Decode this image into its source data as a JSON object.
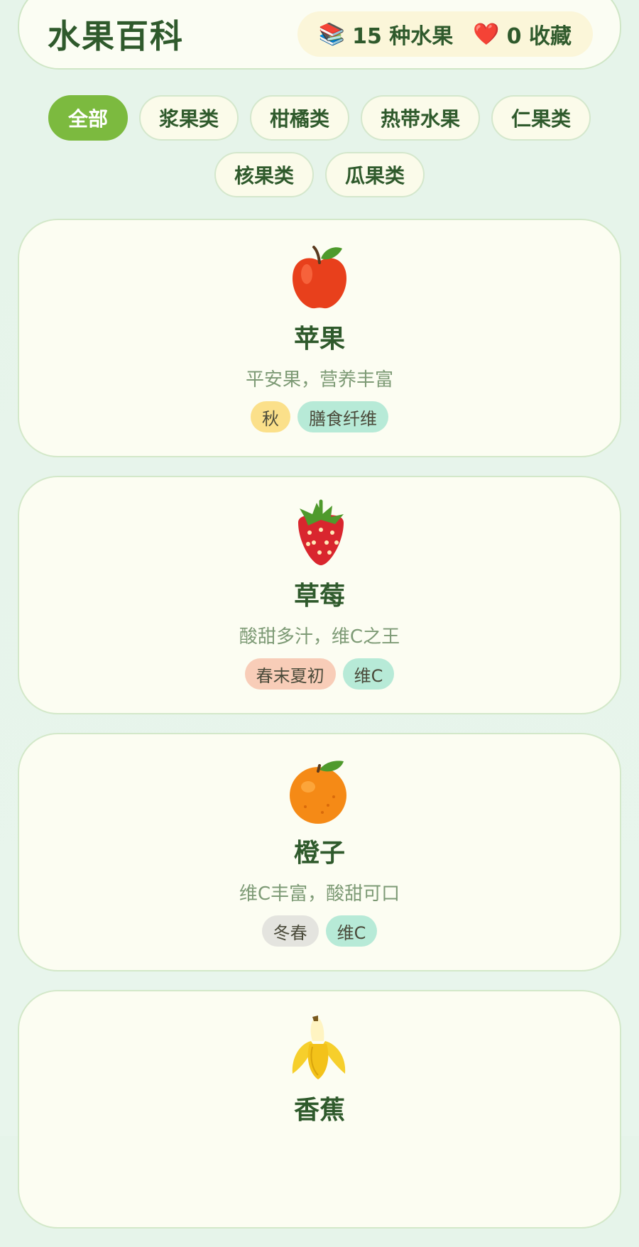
{
  "header": {
    "title": "水果百科",
    "fruit_count": "15 种水果",
    "fav_count": "0 收藏"
  },
  "filters": {
    "row1": [
      "全部",
      "浆果类",
      "柑橘类",
      "热带水果",
      "仁果类"
    ],
    "row2": [
      "核果类",
      "瓜果类"
    ],
    "active": "全部"
  },
  "cards": [
    {
      "name": "苹果",
      "desc": "平安果，营养丰富",
      "icon": "apple-icon",
      "tags": [
        {
          "label": "秋",
          "color": "#fbe08a"
        },
        {
          "label": "膳食纤维",
          "color": "#b7ead7"
        }
      ]
    },
    {
      "name": "草莓",
      "desc": "酸甜多汁，维C之王",
      "icon": "strawberry-icon",
      "tags": [
        {
          "label": "春末夏初",
          "color": "#f8cdb8"
        },
        {
          "label": "维C",
          "color": "#b7ead7"
        }
      ]
    },
    {
      "name": "橙子",
      "desc": "维C丰富，酸甜可口",
      "icon": "orange-icon",
      "tags": [
        {
          "label": "冬春",
          "color": "#e4e4df"
        },
        {
          "label": "维C",
          "color": "#b7ead7"
        }
      ]
    },
    {
      "name": "香蕉",
      "desc": "",
      "icon": "banana-icon",
      "tags": []
    }
  ],
  "colors": {
    "accent": "#7cba3f",
    "text": "#2f5a2c",
    "muted": "#7d9a75"
  }
}
